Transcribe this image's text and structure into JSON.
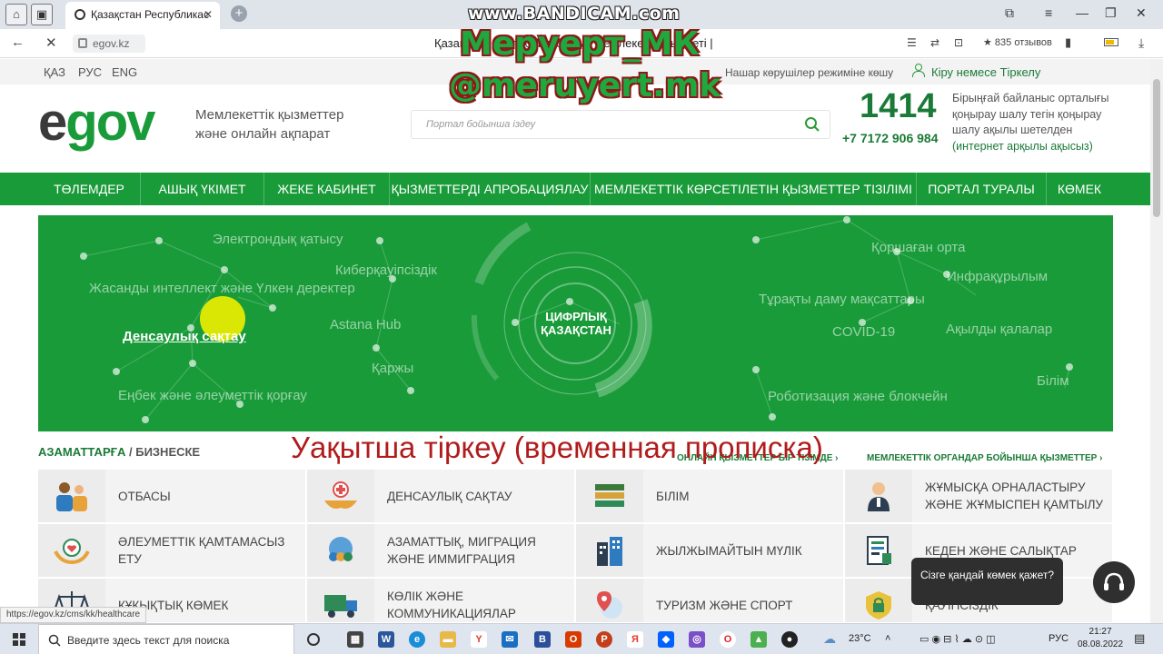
{
  "browser": {
    "bandicam": "www.BANDICAM.com",
    "tab_title": "Қазақстан Республикас",
    "url": "egov.kz",
    "page_title": "Қазақстан Республикасының мемлекеттік қызметі |",
    "reviews": "835 отзывов",
    "status_url": "https://egov.kz/cms/kk/healthcare"
  },
  "overlay": {
    "watermark_line1": "Меруерт_МК",
    "watermark_line2": "@meruyert.mk",
    "caption": "Уақытша тіркеу (временная прописка)"
  },
  "site": {
    "languages": [
      "ҚАЗ",
      "РУС",
      "ENG"
    ],
    "low_vision": "Нашар көрушілер режиміне көшу",
    "login": "Кіру немесе Тіркелу",
    "logo_e": "e",
    "logo_gov": "gov",
    "tagline": "Мемлекеттік қызметтер және онлайн ақпарат",
    "search_placeholder": "Портал бойынша іздеу",
    "hotline_number": "1414",
    "hotline_phone": "+7 7172 906 984",
    "hotline_text": "Бірыңғай байланыс орталығы қоңырау шалу тегін қоңырау шалу ақылы шетелден",
    "hotline_link": "(интернет арқылы ақысыз)"
  },
  "nav": [
    "ТӨЛЕМДЕР",
    "АШЫҚ ҮКІМЕТ",
    "ЖЕКЕ КАБИНЕТ",
    "ҚЫЗМЕТТЕРДІ АПРОБАЦИЯЛАУ",
    "МЕМЛЕКЕТТІК КӨРСЕТІЛЕТІН ҚЫЗМЕТТЕР ТІЗІЛІМІ",
    "ПОРТАЛ ТУРАЛЫ",
    "КӨМЕК"
  ],
  "banner": {
    "center": "ЦИФРЛЫҚ ҚАЗАҚСТАН",
    "labels": [
      "Электрондық қатысу",
      "Киберқауіпсіздік",
      "Жасанды интеллект және Үлкен деректер",
      "Денсаулық сақтау",
      "Astana Hub",
      "Қаржы",
      "Еңбек және әлеуметтік қорғау",
      "Қоршаған орта",
      "Инфрақұрылым",
      "Тұрақты даму мақсаттары",
      "COVID-19",
      "Ақылды қалалар",
      "Білім",
      "Роботизация және блокчейн"
    ]
  },
  "section": {
    "citizens": "АЗАМАТТАРҒА",
    "separator": " / ",
    "business": "БИЗНЕСКЕ",
    "online_services": "ОНЛАЙН ҚЫЗМЕТТЕР БІР ТІЗІМДЕ ›",
    "gov_services": "МЕМЛЕКЕТТІК ОРГАНДАР БОЙЫНША ҚЫЗМЕТТЕР ›"
  },
  "categories": [
    {
      "label": "ОТБАСЫ",
      "icon": "family-icon"
    },
    {
      "label": "ДЕНСАУЛЫҚ САҚТАУ",
      "icon": "healthcare-icon"
    },
    {
      "label": "БІЛІМ",
      "icon": "books-icon"
    },
    {
      "label": "ЖҰМЫСҚА ОРНАЛАСТЫРУ ЖӘНЕ ЖҰМЫСПЕН ҚАМТЫЛУ",
      "icon": "employee-icon"
    },
    {
      "label": "ӘЛЕУМЕТТІК ҚАМТАМАСЫЗ ЕТУ",
      "icon": "social-care-icon"
    },
    {
      "label": "АЗАМАТТЫҚ, МИГРАЦИЯ ЖӘНЕ ИММИГРАЦИЯ",
      "icon": "globe-people-icon"
    },
    {
      "label": "ЖЫЛЖЫМАЙТЫН МҮЛІК",
      "icon": "buildings-icon"
    },
    {
      "label": "КЕДЕН ЖӘНЕ САЛЫҚТАР",
      "icon": "tax-document-icon"
    },
    {
      "label": "ҚҰҚЫҚТЫҚ КӨМЕК",
      "icon": "scales-icon"
    },
    {
      "label": "КӨЛІК ЖӘНЕ КОММУНИКАЦИЯЛАР",
      "icon": "truck-icon"
    },
    {
      "label": "ТУРИЗМ ЖӘНЕ СПОРТ",
      "icon": "map-pin-icon"
    },
    {
      "label": "ҚАУІПСІЗДІК",
      "icon": "security-lock-icon"
    }
  ],
  "chat": {
    "bubble": "Сізге қандай көмек қажет?"
  },
  "taskbar": {
    "search_placeholder": "Введите здесь текст для поиска",
    "weather": "23°C",
    "language": "РУС",
    "time": "21:27",
    "date": "08.08.2022"
  },
  "colors": {
    "brand_green": "#1a9b3a",
    "dark_green": "#1a7a37",
    "caption_red": "#b01c1c"
  }
}
